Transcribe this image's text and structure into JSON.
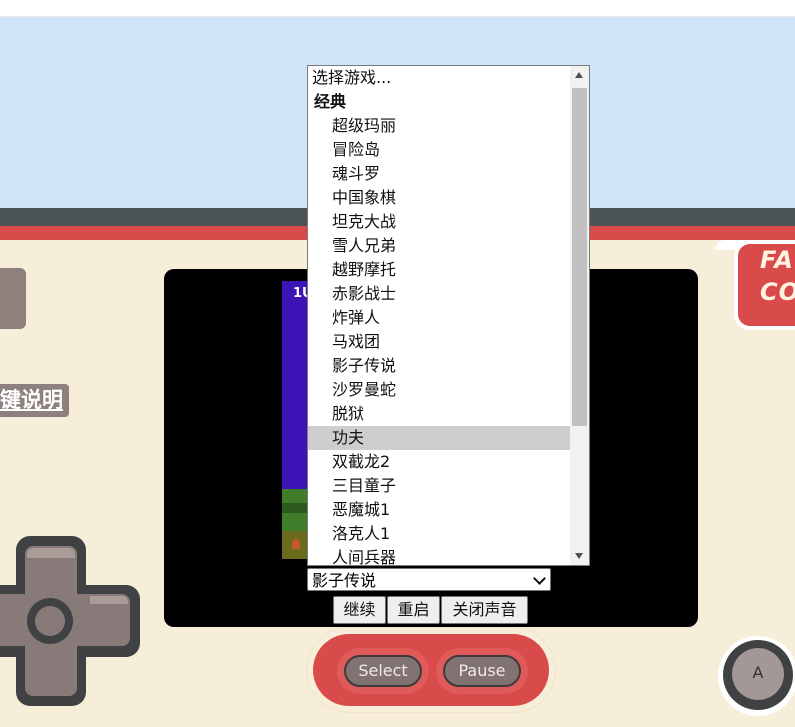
{
  "brand": {
    "line1": "FA",
    "line2": "CO"
  },
  "left_panel": {
    "key_help_label": "键说明"
  },
  "game_screen": {
    "score_text": "1U"
  },
  "game_list": {
    "placeholder": "选择游戏...",
    "group_label": "经典",
    "items": [
      "超级玛丽",
      "冒险岛",
      "魂斗罗",
      "中国象棋",
      "坦克大战",
      "雪人兄弟",
      "越野摩托",
      "赤影战士",
      "炸弹人",
      "马戏团",
      "影子传说",
      "沙罗曼蛇",
      "脱狱",
      "功夫",
      "双截龙2",
      "三目童子",
      "恶魔城1",
      "洛克人1",
      "人间兵器"
    ],
    "highlighted_item": "功夫"
  },
  "game_select": {
    "value": "影子传说"
  },
  "controls": {
    "continue_label": "继续",
    "restart_label": "重启",
    "mute_label": "关闭声音"
  },
  "gamepad": {
    "select_label": "Select",
    "pause_label": "Pause",
    "a_label": "A"
  },
  "colors": {
    "accent_red": "#d94a4a",
    "sky": "#cfe5f7",
    "panel": "#f7eed9",
    "button_gray": "#8d807d"
  }
}
